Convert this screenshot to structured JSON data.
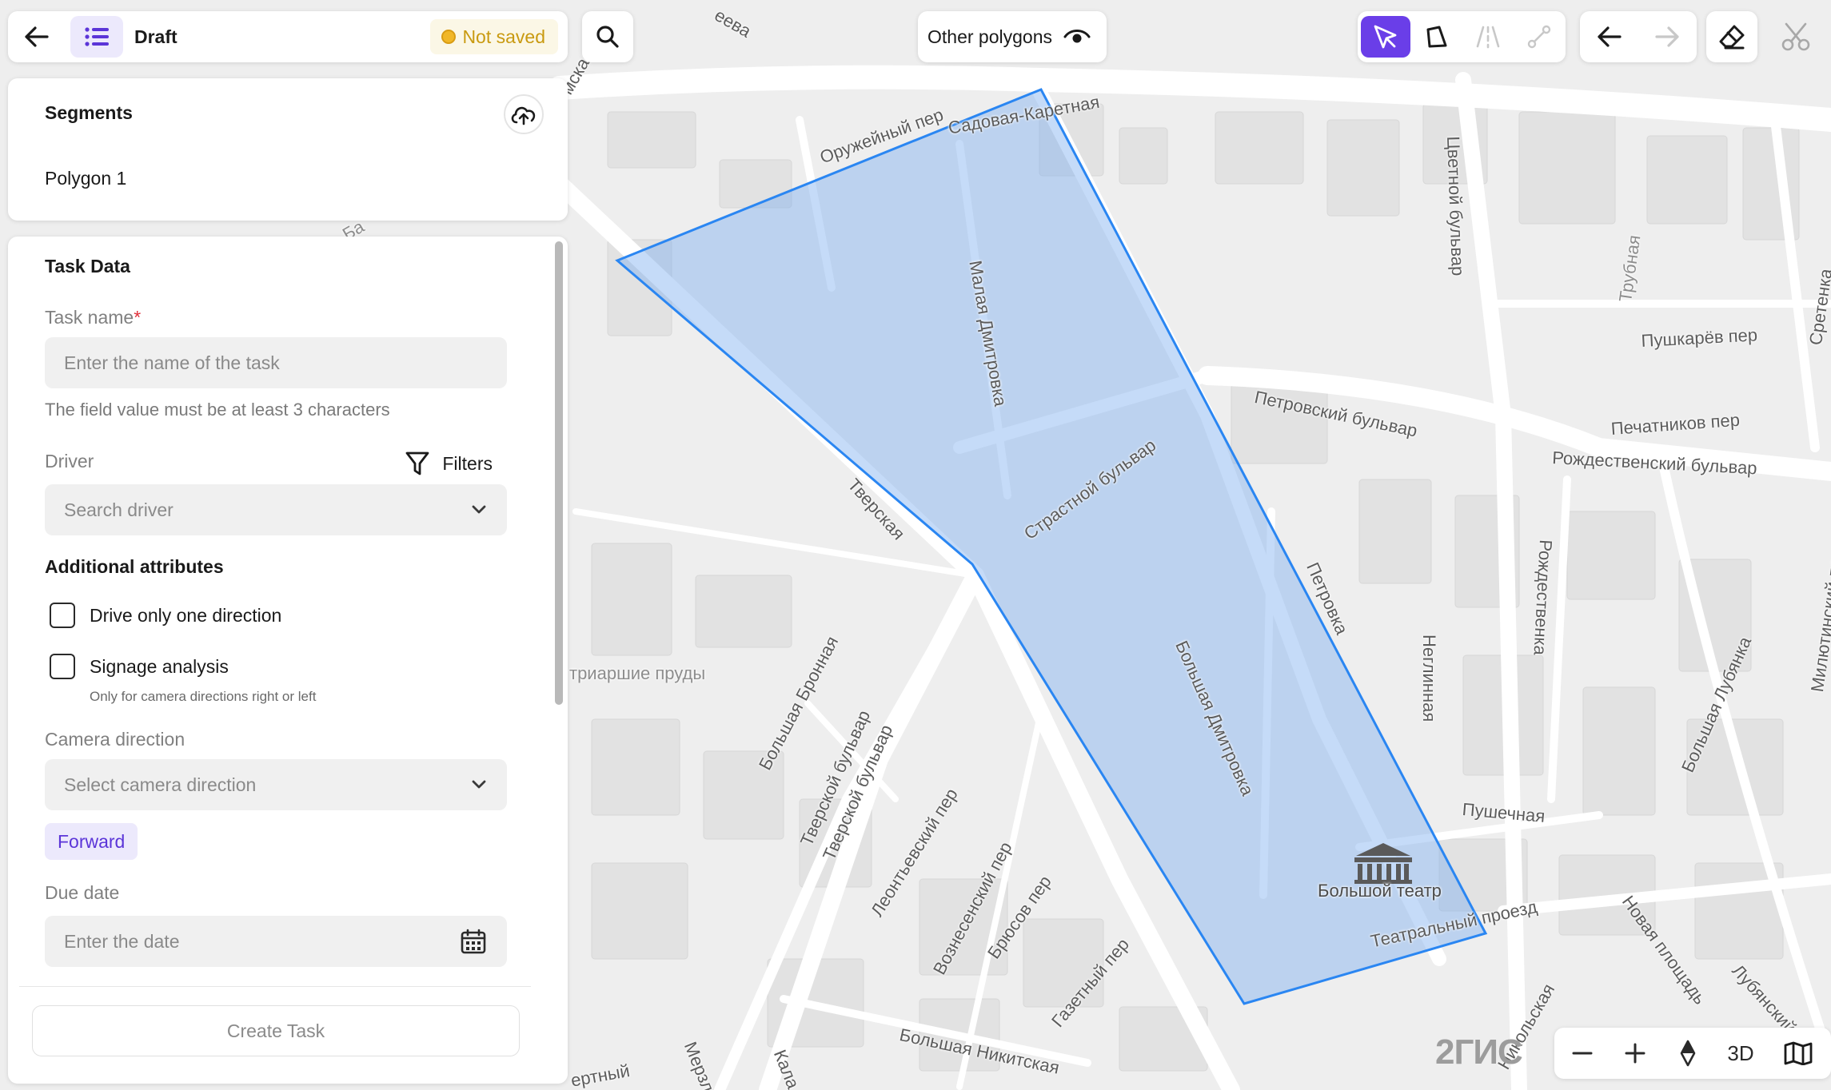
{
  "topbar": {
    "title": "Draft",
    "status": "Not saved"
  },
  "segments": {
    "heading": "Segments",
    "items": [
      "Polygon 1"
    ]
  },
  "task": {
    "heading": "Task Data",
    "task_name_label": "Task name",
    "task_name_required_mark": "*",
    "task_name_placeholder": "Enter the name of the task",
    "task_name_helper": "The field value must be at least 3 characters",
    "driver_label": "Driver",
    "filters_label": "Filters",
    "driver_placeholder": "Search driver",
    "additional_heading": "Additional attributes",
    "drive_one_direction_label": "Drive only one direction",
    "signage_label": "Signage analysis",
    "signage_note": "Only for camera directions right or left",
    "camera_direction_label": "Camera direction",
    "camera_direction_placeholder": "Select camera direction",
    "camera_direction_selected": "Forward",
    "due_date_label": "Due date",
    "due_date_placeholder": "Enter the date",
    "create_button": "Create Task"
  },
  "map_toolbar": {
    "other_polygons_label": "Other polygons",
    "mode_3d_label": "3D",
    "logo_text": "2ГИС"
  },
  "map": {
    "labels": {
      "oruzheyny": "Оружейный пер",
      "sadovaya": "Садовая-Каретная",
      "malaya_dmitrovka": "Малая Дмитровка",
      "tsvetnoy": "Цветной бульвар",
      "trubnaya": "Трубная",
      "pushkarev": "Пушкарёв пер",
      "sretenka": "Сретенка",
      "petrovsky": "Петровский бульвар",
      "pechatnikov": "Печатников пер",
      "rozhdestvensky": "Рождественский бульвар",
      "tverskaya": "Тверская",
      "strastnoy": "Страстной бульвар",
      "petrovka": "Петровка",
      "patriarshie": "триаршие пруды",
      "bolshaya_bronnaya": "Большая Бронная",
      "tverskoy1": "Тверской бульвар",
      "tverskoy2": "Тверской бульвар",
      "leontievsky": "Леонтьевский пер",
      "voznesensky": "Вознесенский пер",
      "bryusov": "Брюсов пер",
      "gazetny": "Газетный пер",
      "bolshaya_nikitskaya": "Большая Никитская",
      "bolshaya_dmitrovka": "Большая Дмитровка",
      "neglinnaya": "Неглинная",
      "rozhdestvenka": "Рождественка",
      "pushechnaya": "Пушечная",
      "bolshoi_theatre": "Большой театр",
      "teatralny": "Театральный проезд",
      "novaya_ploshchad": "Новая площадь",
      "bolshaya_lubyanka": "Большая Лубянка",
      "myasnitsky": "Милютинский пер",
      "lubyansky": "Лубянский",
      "nikolskaya": "Никольская",
      "merzlya": "Мерзля",
      "kala": "Кала",
      "ertny": "ертный",
      "zhevskaya": "еева",
      "mskaya": "мская",
      "bv": "Ба"
    }
  },
  "colors": {
    "accent": "#6a3ee8",
    "accent_soft": "#ece9fc",
    "polygon_fill": "#7fb0f0",
    "polygon_stroke": "#2a86f2",
    "status_text": "#c99a10",
    "status_dot": "#f1b728"
  }
}
